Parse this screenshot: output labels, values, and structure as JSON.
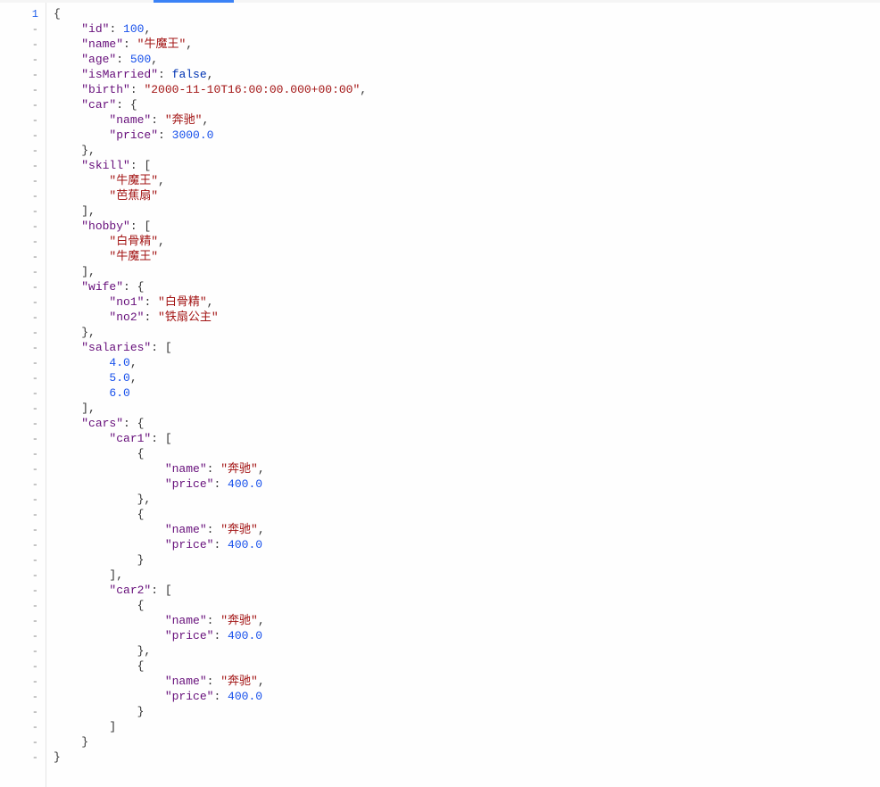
{
  "lineNumber": "1",
  "foldMarker": "-",
  "gutterLines": 50,
  "code": {
    "lines": [
      {
        "indent": 0,
        "parts": [
          {
            "type": "punct",
            "text": "{"
          }
        ]
      },
      {
        "indent": 1,
        "parts": [
          {
            "type": "key",
            "text": "\"id\""
          },
          {
            "type": "punct",
            "text": ": "
          },
          {
            "type": "number",
            "text": "100"
          },
          {
            "type": "punct",
            "text": ","
          }
        ]
      },
      {
        "indent": 1,
        "parts": [
          {
            "type": "key",
            "text": "\"name\""
          },
          {
            "type": "punct",
            "text": ": "
          },
          {
            "type": "string",
            "text": "\"牛魔王\""
          },
          {
            "type": "punct",
            "text": ","
          }
        ]
      },
      {
        "indent": 1,
        "parts": [
          {
            "type": "key",
            "text": "\"age\""
          },
          {
            "type": "punct",
            "text": ": "
          },
          {
            "type": "number",
            "text": "500"
          },
          {
            "type": "punct",
            "text": ","
          }
        ]
      },
      {
        "indent": 1,
        "parts": [
          {
            "type": "key",
            "text": "\"isMarried\""
          },
          {
            "type": "punct",
            "text": ": "
          },
          {
            "type": "boolean",
            "text": "false"
          },
          {
            "type": "punct",
            "text": ","
          }
        ]
      },
      {
        "indent": 1,
        "parts": [
          {
            "type": "key",
            "text": "\"birth\""
          },
          {
            "type": "punct",
            "text": ": "
          },
          {
            "type": "string",
            "text": "\"2000-11-10T16:00:00.000+00:00\""
          },
          {
            "type": "punct",
            "text": ","
          }
        ]
      },
      {
        "indent": 1,
        "parts": [
          {
            "type": "key",
            "text": "\"car\""
          },
          {
            "type": "punct",
            "text": ": {"
          }
        ]
      },
      {
        "indent": 2,
        "parts": [
          {
            "type": "key",
            "text": "\"name\""
          },
          {
            "type": "punct",
            "text": ": "
          },
          {
            "type": "string",
            "text": "\"奔驰\""
          },
          {
            "type": "punct",
            "text": ","
          }
        ]
      },
      {
        "indent": 2,
        "parts": [
          {
            "type": "key",
            "text": "\"price\""
          },
          {
            "type": "punct",
            "text": ": "
          },
          {
            "type": "number",
            "text": "3000.0"
          }
        ]
      },
      {
        "indent": 1,
        "parts": [
          {
            "type": "punct",
            "text": "},"
          }
        ]
      },
      {
        "indent": 1,
        "parts": [
          {
            "type": "key",
            "text": "\"skill\""
          },
          {
            "type": "punct",
            "text": ": ["
          }
        ]
      },
      {
        "indent": 2,
        "parts": [
          {
            "type": "string",
            "text": "\"牛魔王\""
          },
          {
            "type": "punct",
            "text": ","
          }
        ]
      },
      {
        "indent": 2,
        "parts": [
          {
            "type": "string",
            "text": "\"芭蕉扇\""
          }
        ]
      },
      {
        "indent": 1,
        "parts": [
          {
            "type": "punct",
            "text": "],"
          }
        ]
      },
      {
        "indent": 1,
        "parts": [
          {
            "type": "key",
            "text": "\"hobby\""
          },
          {
            "type": "punct",
            "text": ": ["
          }
        ]
      },
      {
        "indent": 2,
        "parts": [
          {
            "type": "string",
            "text": "\"白骨精\""
          },
          {
            "type": "punct",
            "text": ","
          }
        ]
      },
      {
        "indent": 2,
        "parts": [
          {
            "type": "string",
            "text": "\"牛魔王\""
          }
        ]
      },
      {
        "indent": 1,
        "parts": [
          {
            "type": "punct",
            "text": "],"
          }
        ]
      },
      {
        "indent": 1,
        "parts": [
          {
            "type": "key",
            "text": "\"wife\""
          },
          {
            "type": "punct",
            "text": ": {"
          }
        ]
      },
      {
        "indent": 2,
        "parts": [
          {
            "type": "key",
            "text": "\"no1\""
          },
          {
            "type": "punct",
            "text": ": "
          },
          {
            "type": "string",
            "text": "\"白骨精\""
          },
          {
            "type": "punct",
            "text": ","
          }
        ]
      },
      {
        "indent": 2,
        "parts": [
          {
            "type": "key",
            "text": "\"no2\""
          },
          {
            "type": "punct",
            "text": ": "
          },
          {
            "type": "string",
            "text": "\"铁扇公主\""
          }
        ]
      },
      {
        "indent": 1,
        "parts": [
          {
            "type": "punct",
            "text": "},"
          }
        ]
      },
      {
        "indent": 1,
        "parts": [
          {
            "type": "key",
            "text": "\"salaries\""
          },
          {
            "type": "punct",
            "text": ": ["
          }
        ]
      },
      {
        "indent": 2,
        "parts": [
          {
            "type": "number",
            "text": "4.0"
          },
          {
            "type": "punct",
            "text": ","
          }
        ]
      },
      {
        "indent": 2,
        "parts": [
          {
            "type": "number",
            "text": "5.0"
          },
          {
            "type": "punct",
            "text": ","
          }
        ]
      },
      {
        "indent": 2,
        "parts": [
          {
            "type": "number",
            "text": "6.0"
          }
        ]
      },
      {
        "indent": 1,
        "parts": [
          {
            "type": "punct",
            "text": "],"
          }
        ]
      },
      {
        "indent": 1,
        "parts": [
          {
            "type": "key",
            "text": "\"cars\""
          },
          {
            "type": "punct",
            "text": ": {"
          }
        ]
      },
      {
        "indent": 2,
        "parts": [
          {
            "type": "key",
            "text": "\"car1\""
          },
          {
            "type": "punct",
            "text": ": ["
          }
        ]
      },
      {
        "indent": 3,
        "parts": [
          {
            "type": "punct",
            "text": "{"
          }
        ]
      },
      {
        "indent": 4,
        "parts": [
          {
            "type": "key",
            "text": "\"name\""
          },
          {
            "type": "punct",
            "text": ": "
          },
          {
            "type": "string",
            "text": "\"奔驰\""
          },
          {
            "type": "punct",
            "text": ","
          }
        ]
      },
      {
        "indent": 4,
        "parts": [
          {
            "type": "key",
            "text": "\"price\""
          },
          {
            "type": "punct",
            "text": ": "
          },
          {
            "type": "number",
            "text": "400.0"
          }
        ]
      },
      {
        "indent": 3,
        "parts": [
          {
            "type": "punct",
            "text": "},"
          }
        ]
      },
      {
        "indent": 3,
        "parts": [
          {
            "type": "punct",
            "text": "{"
          }
        ]
      },
      {
        "indent": 4,
        "parts": [
          {
            "type": "key",
            "text": "\"name\""
          },
          {
            "type": "punct",
            "text": ": "
          },
          {
            "type": "string",
            "text": "\"奔驰\""
          },
          {
            "type": "punct",
            "text": ","
          }
        ]
      },
      {
        "indent": 4,
        "parts": [
          {
            "type": "key",
            "text": "\"price\""
          },
          {
            "type": "punct",
            "text": ": "
          },
          {
            "type": "number",
            "text": "400.0"
          }
        ]
      },
      {
        "indent": 3,
        "parts": [
          {
            "type": "punct",
            "text": "}"
          }
        ]
      },
      {
        "indent": 2,
        "parts": [
          {
            "type": "punct",
            "text": "],"
          }
        ]
      },
      {
        "indent": 2,
        "parts": [
          {
            "type": "key",
            "text": "\"car2\""
          },
          {
            "type": "punct",
            "text": ": ["
          }
        ]
      },
      {
        "indent": 3,
        "parts": [
          {
            "type": "punct",
            "text": "{"
          }
        ]
      },
      {
        "indent": 4,
        "parts": [
          {
            "type": "key",
            "text": "\"name\""
          },
          {
            "type": "punct",
            "text": ": "
          },
          {
            "type": "string",
            "text": "\"奔驰\""
          },
          {
            "type": "punct",
            "text": ","
          }
        ]
      },
      {
        "indent": 4,
        "parts": [
          {
            "type": "key",
            "text": "\"price\""
          },
          {
            "type": "punct",
            "text": ": "
          },
          {
            "type": "number",
            "text": "400.0"
          }
        ]
      },
      {
        "indent": 3,
        "parts": [
          {
            "type": "punct",
            "text": "},"
          }
        ]
      },
      {
        "indent": 3,
        "parts": [
          {
            "type": "punct",
            "text": "{"
          }
        ]
      },
      {
        "indent": 4,
        "parts": [
          {
            "type": "key",
            "text": "\"name\""
          },
          {
            "type": "punct",
            "text": ": "
          },
          {
            "type": "string",
            "text": "\"奔驰\""
          },
          {
            "type": "punct",
            "text": ","
          }
        ]
      },
      {
        "indent": 4,
        "parts": [
          {
            "type": "key",
            "text": "\"price\""
          },
          {
            "type": "punct",
            "text": ": "
          },
          {
            "type": "number",
            "text": "400.0"
          }
        ]
      },
      {
        "indent": 3,
        "parts": [
          {
            "type": "punct",
            "text": "}"
          }
        ]
      },
      {
        "indent": 2,
        "parts": [
          {
            "type": "punct",
            "text": "]"
          }
        ]
      },
      {
        "indent": 1,
        "parts": [
          {
            "type": "punct",
            "text": "}"
          }
        ]
      },
      {
        "indent": 0,
        "parts": [
          {
            "type": "punct",
            "text": "}"
          }
        ]
      }
    ]
  }
}
